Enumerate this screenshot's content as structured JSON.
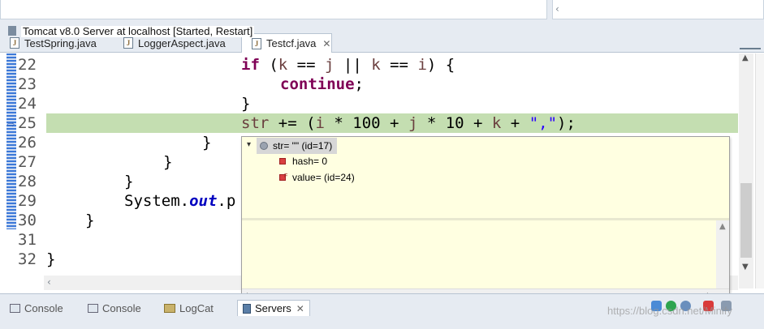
{
  "editor_tabs": [
    {
      "label": "TestSpring.java",
      "active": false
    },
    {
      "label": "LoggerAspect.java",
      "active": false
    },
    {
      "label": "Testcf.java",
      "active": true
    }
  ],
  "tab_close_glyph": "✕",
  "code": {
    "line_numbers": [
      "22",
      "23",
      "24",
      "25",
      "26",
      "27",
      "28",
      "29",
      "30",
      "31",
      "32"
    ],
    "current_line": "25",
    "line22": {
      "kw_if": "if",
      "t1": " (",
      "v_k": "k",
      "t2": " == ",
      "v_j": "j",
      "t3": " || ",
      "v_k2": "k",
      "t4": " == ",
      "v_i": "i",
      "t5": ") {"
    },
    "line23": {
      "kw_continue": "continue",
      "t1": ";"
    },
    "line24": {
      "t1": "}"
    },
    "line25": {
      "v_str": "str",
      "t1": " += (",
      "v_i": "i",
      "t2": " * 100 + ",
      "v_j": "j",
      "t3": " * 10 + ",
      "v_k": "k",
      "t4": " + ",
      "s_lit": "\",\"",
      "t5": ");"
    },
    "line26": {
      "t1": "}"
    },
    "line27": {
      "t1": "}"
    },
    "line28": {
      "t1": "}"
    },
    "line29": {
      "t1": "System.",
      "f_out": "out",
      "t2": ".p"
    },
    "line30": {
      "t1": "}"
    },
    "line31": {
      "t1": ""
    },
    "line32": {
      "t1": "}"
    }
  },
  "debug_hover": {
    "root_label": "str= \"\" (id=17)",
    "children": [
      {
        "label": "hash= 0",
        "final": false
      },
      {
        "label": "value= (id=24)",
        "final": true
      }
    ]
  },
  "bottom_views": [
    {
      "label": "Console",
      "icon": "console-icon",
      "active": false
    },
    {
      "label": "Console",
      "icon": "console-icon",
      "active": false
    },
    {
      "label": "LogCat",
      "icon": "logcat-icon",
      "active": false
    },
    {
      "label": "Servers",
      "icon": "servers-icon",
      "active": true
    }
  ],
  "server_entry": "Tomcat v8.0 Server at localhost  [Started, Restart]",
  "watermark": "https://blog.csdn.net/Minify",
  "colors": {
    "current_line_bg": "#c4deb1",
    "keyword": "#7f0055",
    "local_var": "#6a3e3e",
    "string_literal": "#2a00ff",
    "static_field": "#0000c0",
    "hover_bg": "#ffffe1"
  }
}
